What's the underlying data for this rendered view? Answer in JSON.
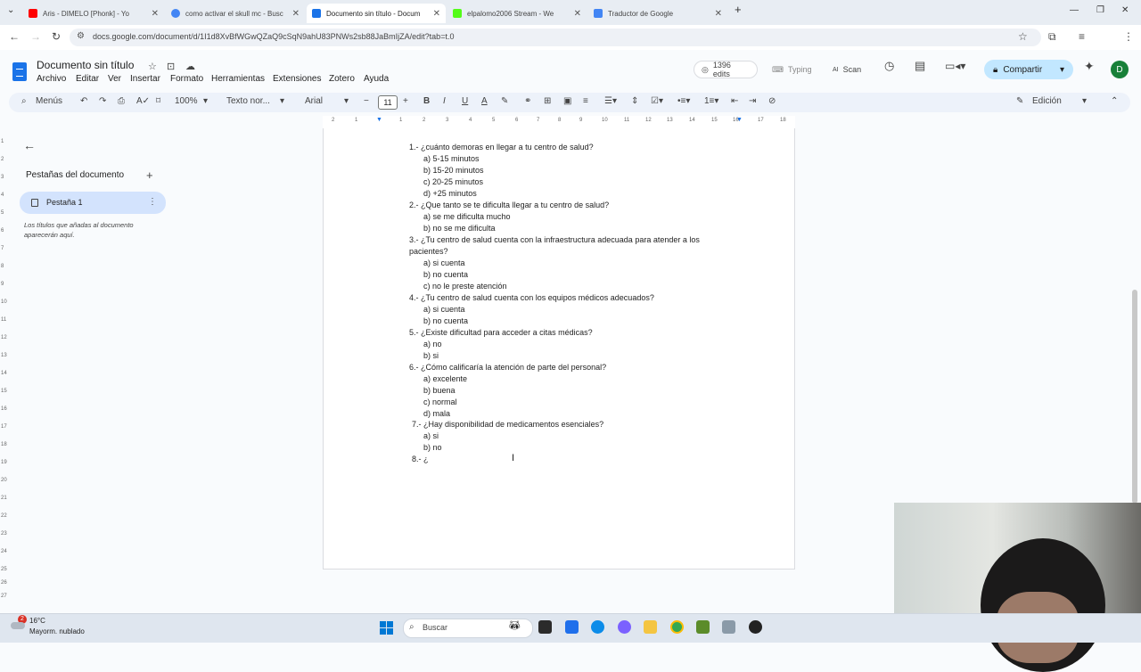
{
  "browser": {
    "tabs": [
      {
        "title": "Aris - DIMELO [Phonk] - Yo",
        "favicon_color": "#ff0000"
      },
      {
        "title": "como activar el skull mc - Busc",
        "favicon_color": "#4285f4"
      },
      {
        "title": "Documento sin título - Docum",
        "favicon_color": "#1a73e8"
      },
      {
        "title": "elpalomo2006 Stream - We",
        "favicon_color": "#53fc18"
      },
      {
        "title": "Traductor de Google",
        "favicon_color": "#4285f4"
      }
    ],
    "url": "docs.google.com/document/d/1I1d8XvBfWGwQZaQ9cSqN9ahU83PNWs2sb88JaBmIjZA/edit?tab=t.0"
  },
  "docs": {
    "title": "Documento sin título",
    "menus": [
      "Archivo",
      "Editar",
      "Ver",
      "Insertar",
      "Formato",
      "Herramientas",
      "Extensiones",
      "Zotero",
      "Ayuda"
    ],
    "edits": "1396 edits",
    "typing": "Typing",
    "scan": "Scan",
    "share": "Compartir",
    "avatar": "D",
    "toolbar": {
      "search": "Menús",
      "zoom": "100%",
      "style": "Texto nor...",
      "font": "Arial",
      "font_size": "11",
      "mode": "Edición"
    },
    "ruler_ticks": [
      "2",
      "1",
      "1",
      "2",
      "3",
      "4",
      "5",
      "6",
      "7",
      "8",
      "9",
      "10",
      "11",
      "12",
      "13",
      "14",
      "15",
      "16",
      "17",
      "18"
    ],
    "vruler_ticks": [
      "1",
      "2",
      "3",
      "4",
      "5",
      "6",
      "7",
      "8",
      "9",
      "10",
      "11",
      "12",
      "13",
      "14",
      "15",
      "16",
      "17",
      "18",
      "19",
      "20",
      "21",
      "22",
      "23",
      "24",
      "25",
      "26",
      "27"
    ]
  },
  "sidebar": {
    "title": "Pestañas del documento",
    "tab_label": "Pestaña 1",
    "hint": "Los títulos que añadas al documento aparecerán aquí."
  },
  "document": {
    "lines": [
      "1.- ¿cuánto demoras en llegar a tu centro de salud?",
      "a)  5-15 minutos",
      "b)  15-20 minutos",
      "c)  20-25 minutos",
      "d)  +25 minutos",
      "2.- ¿Que tanto se te dificulta llegar a tu centro de salud?",
      "a)  se me dificulta mucho",
      "b)   no se me dificulta",
      "3.- ¿Tu centro de salud cuenta con la infraestructura adecuada para atender a los",
      "pacientes?",
      "a)  si cuenta",
      "b)  no cuenta",
      "c)  no le preste atención",
      "4.- ¿Tu centro de salud cuenta con los equipos médicos adecuados?",
      "a)  si cuenta",
      "b)  no cuenta",
      "5.- ¿Existe dificultad para acceder a citas médicas?",
      "a)  no",
      "b)  si",
      "6.- ¿Cómo calificaría la atención de parte del personal?",
      "a) excelente",
      "b) buena",
      "c)  normal",
      "d) mala",
      "7.- ¿Hay disponibilidad de medicamentos esenciales?",
      "a) si",
      "b) no",
      "8.- ¿"
    ]
  },
  "taskbar": {
    "weather_badge": "2",
    "temperature": "16°C",
    "condition": "Mayorm. nublado",
    "search": "Buscar"
  }
}
